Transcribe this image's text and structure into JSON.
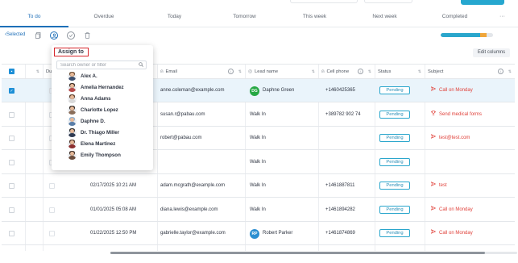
{
  "tabs": [
    "To do",
    "Overdue",
    "Today",
    "Tomorrow",
    "This week",
    "Next week",
    "Completed"
  ],
  "active_tab": "To do",
  "toolbar": {
    "selected_label": "Selected",
    "more_label": "···"
  },
  "progress": {
    "value": 0.88,
    "accent_fraction": 0.12
  },
  "edit_columns_label": "Edit columns",
  "table": {
    "headers": {
      "due": "Du",
      "email": "Email",
      "lead": "Lead name",
      "phone": "Cell phone",
      "status": "Status",
      "subject": "Subject"
    },
    "rows": [
      {
        "selected": true,
        "due": "",
        "email": "anne.coleman@example.com",
        "lead_initials": "DG",
        "lead_color": "#27a844",
        "lead": "Daphne Green",
        "phone": "+1460425365",
        "status": "Pending",
        "subject_icon": "send-icon",
        "subject": "Call on Monday"
      },
      {
        "selected": false,
        "due": "",
        "email": "susan.r@pabau.com",
        "lead_initials": "",
        "lead_color": "",
        "lead": "Walk In",
        "phone": "+389782 902 74",
        "status": "Pending",
        "subject_icon": "trophy-icon",
        "subject": "Send medical forms"
      },
      {
        "selected": false,
        "due": "",
        "email": "robert@pabau.com",
        "lead_initials": "",
        "lead_color": "",
        "lead": "Walk In",
        "phone": "",
        "status": "Pending",
        "subject_icon": "send-icon",
        "subject": "test@test.com"
      },
      {
        "selected": false,
        "due": "",
        "email": "",
        "lead_initials": "",
        "lead_color": "",
        "lead": "Walk In",
        "phone": "",
        "status": "Pending",
        "subject_icon": "",
        "subject": ""
      },
      {
        "selected": false,
        "due": "02/17/2025 10:21 AM",
        "email": "adam.mcgrath@example.com",
        "lead_initials": "",
        "lead_color": "",
        "lead": "Walk In",
        "phone": "+1461887811",
        "status": "Pending",
        "subject_icon": "send-icon",
        "subject": "test"
      },
      {
        "selected": false,
        "due": "01/01/2025 05:08 AM",
        "email": "diana.lewis@example.com",
        "lead_initials": "",
        "lead_color": "",
        "lead": "Walk In",
        "phone": "+1461894282",
        "status": "Pending",
        "subject_icon": "send-icon",
        "subject": "Call on Monday"
      },
      {
        "selected": false,
        "due": "01/22/2025 12:50 PM",
        "email": "gabrielle.taylor@example.com",
        "lead_initials": "RP",
        "lead_color": "#2b8fd1",
        "lead": "Robert Parker",
        "phone": "+1461874869",
        "status": "Pending",
        "subject_icon": "send-icon",
        "subject": "Call on Monday"
      }
    ]
  },
  "assign_popup": {
    "title": "Assign to",
    "search_placeholder": "Search owner or filter",
    "owners": [
      {
        "name": "Alex A.",
        "hair": "#6b4a2f",
        "shirt": "#3c4f6e"
      },
      {
        "name": "Amelia Hernandez",
        "hair": "#3a2a20",
        "shirt": "#b64a4a"
      },
      {
        "name": "Anna Adams",
        "hair": "#5a3a26",
        "shirt": "#d9d9d9"
      },
      {
        "name": "Charlotte Lopez",
        "hair": "#2d241f",
        "shirt": "#8a6e5a"
      },
      {
        "name": "Daphne D.",
        "hair": "#8fb0d0",
        "shirt": "#5a7ea8"
      },
      {
        "name": "Dr. Thiago Miller",
        "hair": "#2b2b2b",
        "shirt": "#2f3b52"
      },
      {
        "name": "Elena Martinez",
        "hair": "#4a2f22",
        "shirt": "#8c2f2f"
      },
      {
        "name": "Emily Thompson",
        "hair": "#3b2a22",
        "shirt": "#6b4d3d"
      }
    ]
  },
  "colors": {
    "accent": "#1e6fb8",
    "status_border": "#2aa6cc",
    "subject": "#e0413a",
    "highlight": "#d7262b"
  }
}
